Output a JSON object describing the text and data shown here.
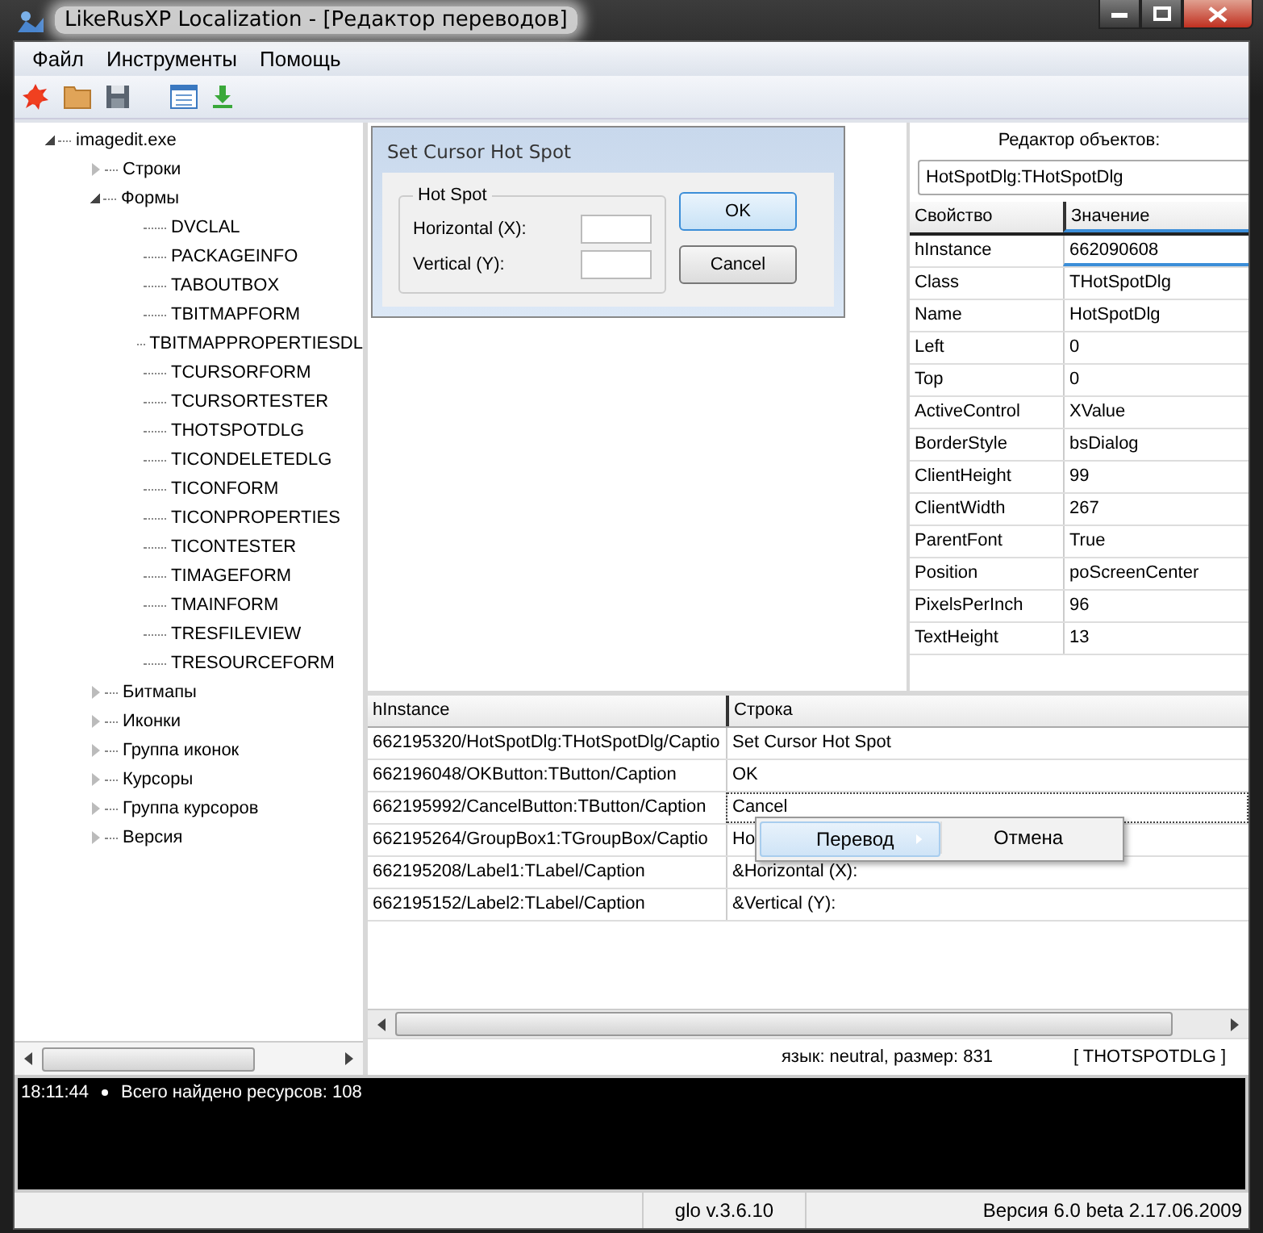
{
  "window": {
    "title": "LikeRusXP Localization - [Редактор переводов]"
  },
  "menu": [
    "Файл",
    "Инструменты",
    "Помощь"
  ],
  "tree": [
    {
      "label": "imagedit.exe",
      "expanded": true,
      "children": [
        {
          "label": "Строки",
          "expanded": false
        },
        {
          "label": "Формы",
          "expanded": true,
          "children": [
            {
              "label": "DVCLAL"
            },
            {
              "label": "PACKAGEINFO"
            },
            {
              "label": "TABOUTBOX"
            },
            {
              "label": "TBITMAPFORM"
            },
            {
              "label": "TBITMAPPROPERTIESDL"
            },
            {
              "label": "TCURSORFORM"
            },
            {
              "label": "TCURSORTESTER"
            },
            {
              "label": "THOTSPOTDLG"
            },
            {
              "label": "TICONDELETEDLG"
            },
            {
              "label": "TICONFORM"
            },
            {
              "label": "TICONPROPERTIES"
            },
            {
              "label": "TICONTESTER"
            },
            {
              "label": "TIMAGEFORM"
            },
            {
              "label": "TMAINFORM"
            },
            {
              "label": "TRESFILEVIEW"
            },
            {
              "label": "TRESOURCEFORM"
            }
          ]
        },
        {
          "label": "Битмапы",
          "expanded": false
        },
        {
          "label": "Иконки",
          "expanded": false
        },
        {
          "label": "Группа иконок",
          "expanded": false
        },
        {
          "label": "Курсоры",
          "expanded": false
        },
        {
          "label": "Группа курсоров",
          "expanded": false
        },
        {
          "label": "Версия",
          "expanded": false
        }
      ]
    }
  ],
  "preview_dialog": {
    "title": "Set Cursor Hot Spot",
    "group": "Hot Spot",
    "fields": [
      {
        "label": "Horizontal (X):"
      },
      {
        "label": "Vertical (Y):"
      }
    ],
    "buttons": [
      {
        "label": "OK",
        "default": true
      },
      {
        "label": "Cancel",
        "default": false
      }
    ]
  },
  "object_inspector": {
    "title": "Редактор объектов:",
    "object": "HotSpotDlg:THotSpotDlg",
    "columns": [
      "Свойство",
      "Значение"
    ],
    "rows": [
      {
        "property": "hInstance",
        "value": "662090608",
        "selected": true
      },
      {
        "property": "Class",
        "value": "THotSpotDlg",
        "selected": false
      },
      {
        "property": "Name",
        "value": "HotSpotDlg",
        "selected": false
      },
      {
        "property": "Left",
        "value": "0",
        "selected": false
      },
      {
        "property": "Top",
        "value": "0",
        "selected": false
      },
      {
        "property": "ActiveControl",
        "value": "XValue",
        "selected": false
      },
      {
        "property": "BorderStyle",
        "value": "bsDialog",
        "selected": false
      },
      {
        "property": "ClientHeight",
        "value": "99",
        "selected": false
      },
      {
        "property": "ClientWidth",
        "value": "267",
        "selected": false
      },
      {
        "property": "ParentFont",
        "value": "True",
        "selected": false
      },
      {
        "property": "Position",
        "value": "poScreenCenter",
        "selected": false
      },
      {
        "property": "PixelsPerInch",
        "value": "96",
        "selected": false
      },
      {
        "property": "TextHeight",
        "value": "13",
        "selected": false
      }
    ]
  },
  "strings_table": {
    "columns": [
      "hInstance",
      "Строка"
    ],
    "rows": [
      {
        "id": "662195320/HotSpotDlg:THotSpotDlg/Captio",
        "text": "Set Cursor Hot Spot",
        "selected": false
      },
      {
        "id": "662196048/OKButton:TButton/Caption",
        "text": "OK",
        "selected": false
      },
      {
        "id": "662195992/CancelButton:TButton/Caption",
        "text": "Cancel",
        "selected": true
      },
      {
        "id": "662195264/GroupBox1:TGroupBox/Captio",
        "text": "Ho",
        "selected": false
      },
      {
        "id": "662195208/Label1:TLabel/Caption",
        "text": "&Horizontal (X):",
        "selected": false
      },
      {
        "id": "662195152/Label2:TLabel/Caption",
        "text": "&Vertical (Y):",
        "selected": false
      }
    ]
  },
  "context_menu": {
    "items": [
      {
        "label": "Перевод",
        "highlighted": true,
        "submenu": true
      },
      {
        "label": "Отмена",
        "highlighted": false,
        "submenu": false
      }
    ]
  },
  "info": {
    "language": "язык: neutral,  размер: 831",
    "resource": "[ THOTSPOTDLG ]"
  },
  "log": [
    {
      "time": "18:11:44",
      "message": "Всего найдено ресурсов: 108"
    }
  ],
  "status_bar": [
    "glo v.3.6.10",
    "Версия 6.0 beta 2.17.06.2009"
  ]
}
